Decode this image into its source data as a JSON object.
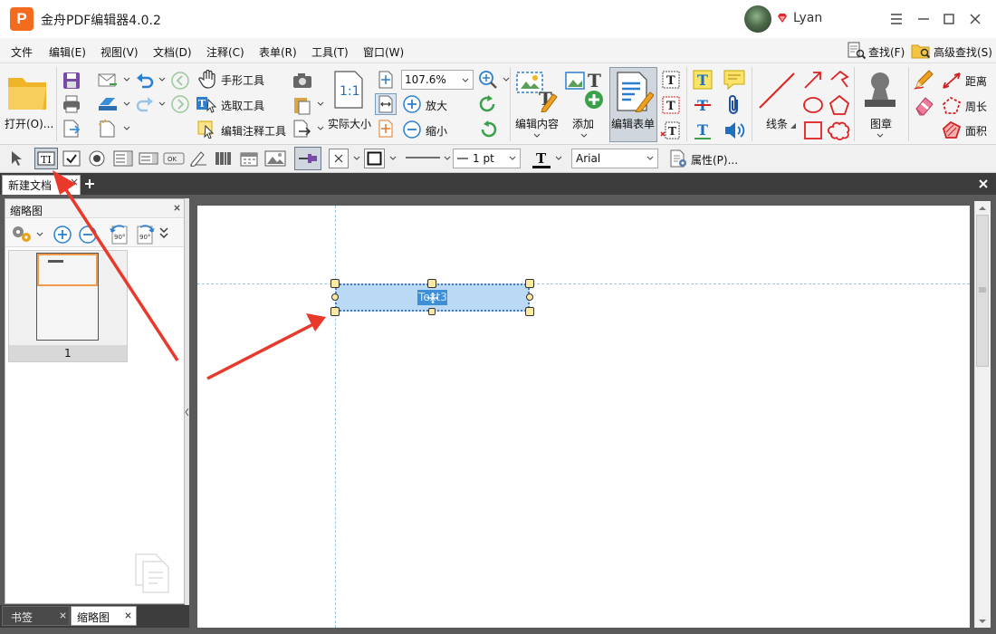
{
  "app": {
    "logo_letter": "P",
    "title": "金舟PDF编辑器4.0.2",
    "user_name": "Lyan",
    "accent_color": "#f36b1c"
  },
  "menu": {
    "items": [
      "文件",
      "编辑(E)",
      "视图(V)",
      "文档(D)",
      "注释(C)",
      "表单(R)",
      "工具(T)",
      "窗口(W)"
    ]
  },
  "search": {
    "find": "查找(F)",
    "advanced_find": "高级查找(S)"
  },
  "ribbon": {
    "open": "打开(O)...",
    "hand_tool": "手形工具",
    "select_tool": "选取工具",
    "edit_annotation_tool": "编辑注释工具",
    "actual_size": "实际大小",
    "zoom_value": "107.6%",
    "zoom_in": "放大",
    "zoom_out": "缩小",
    "edit_content": "编辑内容",
    "add": "添加",
    "edit_form": "编辑表单",
    "lines": "线条",
    "stamp": "图章",
    "distance": "距离",
    "perimeter": "周长",
    "area": "面积"
  },
  "formbar": {
    "line_width": "1 pt",
    "font": "Arial",
    "properties": "属性(P)..."
  },
  "tabs": {
    "document": "新建文档"
  },
  "panel": {
    "title": "缩略图",
    "page_number": "1",
    "rotate_label": "90°",
    "bookmarks_tab": "书签",
    "thumbnails_tab": "缩略图"
  },
  "field": {
    "label": "Text3"
  }
}
